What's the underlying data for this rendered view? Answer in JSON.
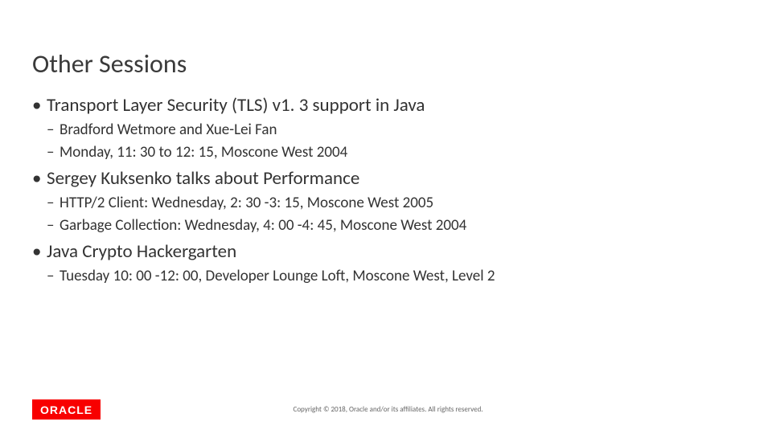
{
  "title": "Other Sessions",
  "sessions": [
    {
      "heading": "Transport Layer Security (TLS) v1. 3 support in Java",
      "details": [
        "Bradford Wetmore and Xue-Lei Fan",
        "Monday, 11: 30 to 12: 15, Moscone West 2004"
      ]
    },
    {
      "heading": "Sergey Kuksenko talks about Performance",
      "details": [
        "HTTP/2 Client: Wednesday, 2: 30 -3: 15, Moscone West 2005",
        "Garbage Collection: Wednesday, 4: 00 -4: 45, Moscone West 2004"
      ]
    },
    {
      "heading": "Java Crypto Hackergarten",
      "details": [
        "Tuesday 10: 00 -12: 00, Developer Lounge Loft, Moscone West, Level 2"
      ]
    }
  ],
  "logo_text": "ORACLE",
  "copyright": "Copyright © 2018, Oracle and/or its affiliates. All rights reserved."
}
